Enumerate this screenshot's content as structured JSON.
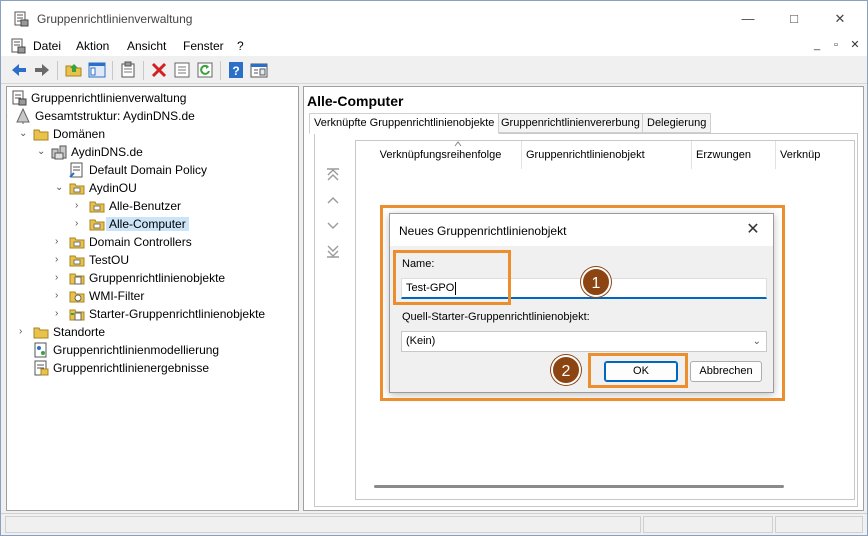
{
  "window": {
    "title": "Gruppenrichtlinienverwaltung",
    "controls": {
      "minimize": "—",
      "maximize": "□",
      "close": "✕"
    }
  },
  "menu": {
    "items": [
      "Datei",
      "Aktion",
      "Ansicht",
      "Fenster",
      "?"
    ],
    "mdi_controls": {
      "minimize": "_",
      "restore": "▫",
      "close": "✕"
    }
  },
  "toolbar": {
    "icons": [
      "back-arrow-icon",
      "forward-arrow-icon",
      "folder-up-icon",
      "show-tree-icon",
      "clipboard-icon",
      "delete-icon",
      "properties-icon",
      "refresh-icon",
      "help-icon",
      "console-icon"
    ]
  },
  "tree": {
    "nodes": [
      {
        "label": "Gruppenrichtlinienverwaltung",
        "expander": "",
        "icon": "gpmc-root-icon"
      },
      {
        "label": "Gesamtstruktur: AydinDNS.de",
        "expander": "⌄",
        "icon": "forest-icon"
      },
      {
        "label": "Domänen",
        "expander": "⌄",
        "icon": "folder-icon"
      },
      {
        "label": "AydinDNS.de",
        "expander": "⌄",
        "icon": "domain-icon"
      },
      {
        "label": "Default Domain Policy",
        "expander": "",
        "icon": "gpo-link-icon"
      },
      {
        "label": "AydinOU",
        "expander": "⌄",
        "icon": "ou-folder-icon"
      },
      {
        "label": "Alle-Benutzer",
        "expander": "›",
        "icon": "ou-folder-icon"
      },
      {
        "label": "Alle-Computer",
        "expander": "›",
        "icon": "ou-folder-icon"
      },
      {
        "label": "Domain Controllers",
        "expander": "›",
        "icon": "ou-folder-icon"
      },
      {
        "label": "TestOU",
        "expander": "›",
        "icon": "ou-folder-icon"
      },
      {
        "label": "Gruppenrichtlinienobjekte",
        "expander": "›",
        "icon": "gpo-folder-icon"
      },
      {
        "label": "WMI-Filter",
        "expander": "›",
        "icon": "wmi-folder-icon"
      },
      {
        "label": "Starter-Gruppenrichtlinienobjekte",
        "expander": "›",
        "icon": "starter-gpo-folder-icon"
      },
      {
        "label": "Standorte",
        "expander": "›",
        "icon": "sites-folder-icon"
      },
      {
        "label": "Gruppenrichtlinienmodellierung",
        "expander": "",
        "icon": "modeling-icon"
      },
      {
        "label": "Gruppenrichtlinienergebnisse",
        "expander": "",
        "icon": "results-icon"
      }
    ],
    "selected": "Alle-Computer"
  },
  "right_panel": {
    "heading": "Alle-Computer",
    "tabs": [
      "Verknüpfte Gruppenrichtlinienobjekte",
      "Gruppenrichtlinienvererbung",
      "Delegierung"
    ],
    "columns": [
      "Verknüpfungsreihenfolge",
      "Gruppenrichtlinienobjekt",
      "Erzwungen",
      "Verknüp"
    ]
  },
  "dialog": {
    "title": "Neues Gruppenrichtlinienobjekt",
    "close": "✕",
    "name_label": "Name:",
    "name_value": "Test-GPO",
    "starter_label": "Quell-Starter-Gruppenrichtlinienobjekt:",
    "starter_value": "(Kein)",
    "ok": "OK",
    "cancel": "Abbrechen"
  },
  "annotations": {
    "step1": "1",
    "step2": "2",
    "highlight_color": "#ec8e2d",
    "badge_color": "#8b4412"
  },
  "colors": {
    "accent": "#0067c0",
    "selection": "#cce4f7",
    "toolbar_blue": "#2c6fc8",
    "delete_red": "#d32020",
    "folder_yellow": "#e9c24b"
  }
}
